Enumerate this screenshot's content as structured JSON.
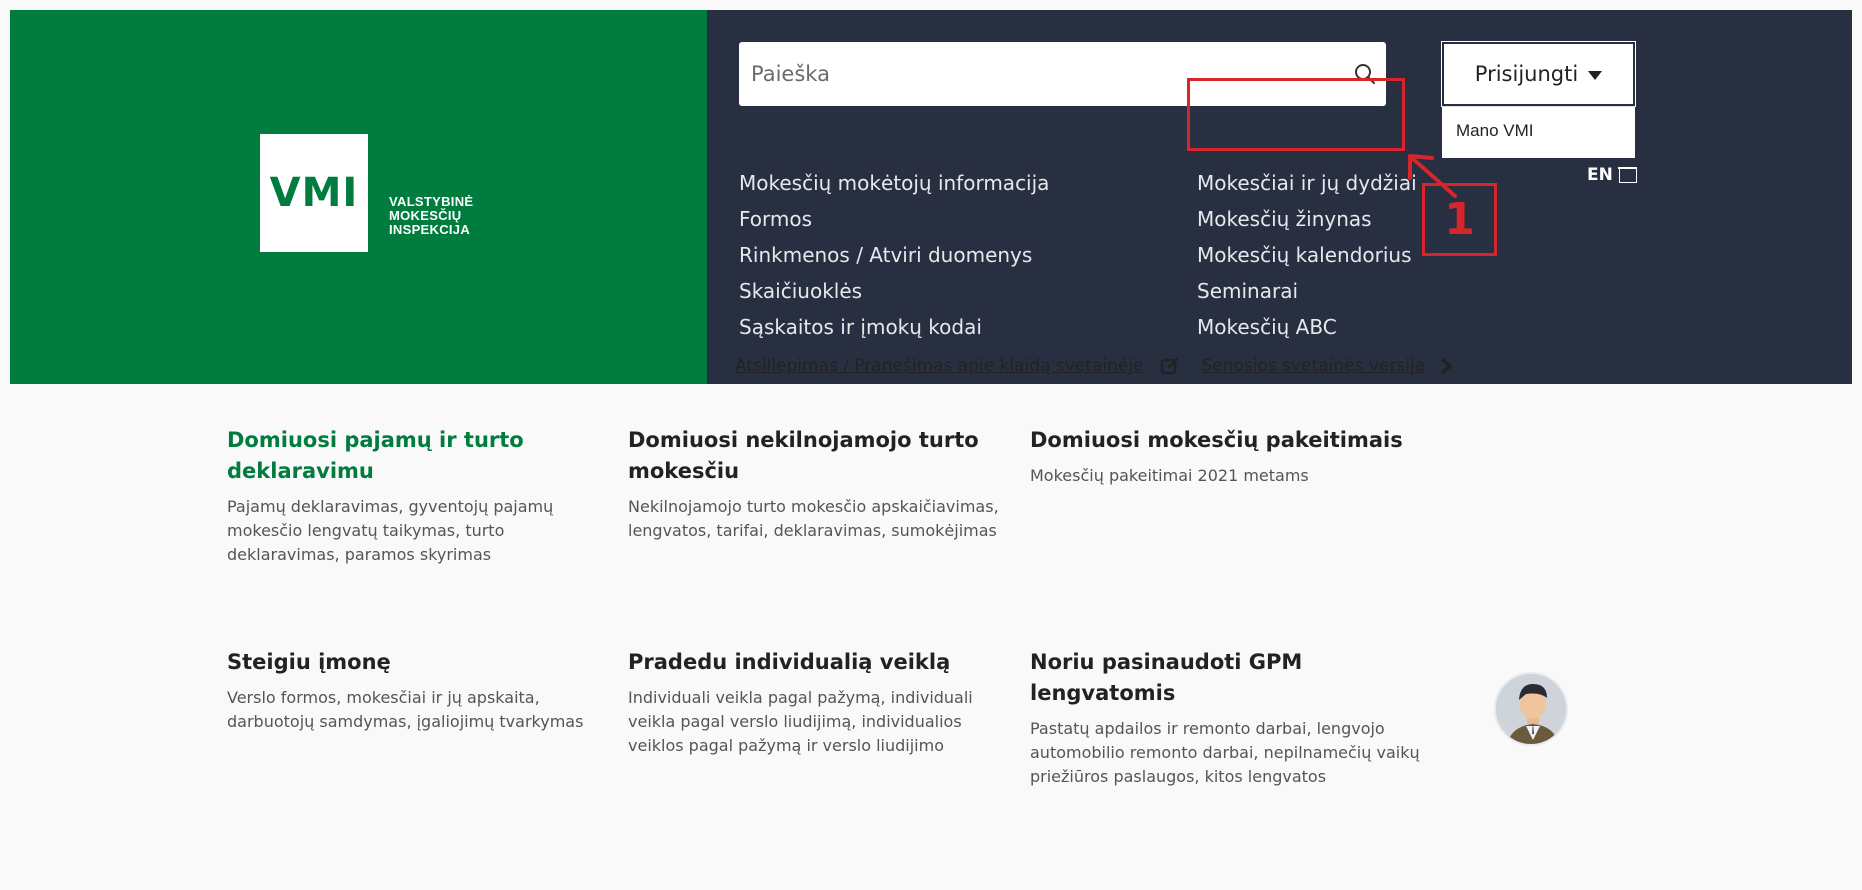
{
  "header": {
    "logo": {
      "mark": "VMI",
      "subtitle_lines": [
        "VALSTYBINĖ",
        "MOKESČIŲ",
        "INSPEKCIJA"
      ]
    },
    "search": {
      "placeholder": "Paieška"
    },
    "login": {
      "label": "Prisijungti",
      "dropdown_item": "Mano VMI"
    },
    "language": "EN",
    "nav_left": [
      "Mokesčių mokėtojų informacija",
      "Formos",
      "Rinkmenos / Atviri duomenys",
      "Skaičiuoklės",
      "Sąskaitos ir įmokų kodai"
    ],
    "nav_right": [
      "Mokesčiai ir jų dydžiai",
      "Mokesčių žinynas",
      "Mokesčių kalendorius",
      "Seminarai",
      "Mokesčių ABC"
    ]
  },
  "annotation": {
    "number": "1",
    "color": "#d6252b"
  },
  "util_links": {
    "feedback": "Atsiliepimas / Pranešimas apie klaidą svetainėje",
    "old_site": "Senosios svetainės versija"
  },
  "cards": [
    {
      "title": "Domiuosi pajamų ir turto deklaravimu",
      "description": "Pajamų deklaravimas, gyventojų pajamų mokesčio lengvatų taikymas, turto deklaravimas, paramos skyrimas"
    },
    {
      "title": "Domiuosi nekilnojamojo turto mokesčiu",
      "description": "Nekilnojamojo turto mokesčio apskaičiavimas, lengvatos, tarifai, deklaravimas, sumokėjimas"
    },
    {
      "title": "Domiuosi mokesčių pakeitimais",
      "description": "Mokesčių pakeitimai 2021 metams"
    },
    {
      "title": "Steigiu įmonę",
      "description": "Verslo formos, mokesčiai ir jų apskaita, darbuotojų samdymas, įgaliojimų tvarkymas"
    },
    {
      "title": "Pradedu individualią veiklą",
      "description": "Individuali veikla pagal pažymą, individuali veikla pagal verslo liudijimą, individualios veiklos pagal pažymą ir verslo liudijimo"
    },
    {
      "title": "Noriu pasinaudoti GPM lengvatomis",
      "description": "Pastatų apdailos ir remonto darbai, lengvojo automobilio remonto darbai, nepilnamečių vaikų priežiūros paslaugos, kitos lengvatos"
    }
  ],
  "colors": {
    "brand_green": "#007c3e",
    "nav_dark": "#272f41",
    "annotation_red": "#d6252b"
  }
}
